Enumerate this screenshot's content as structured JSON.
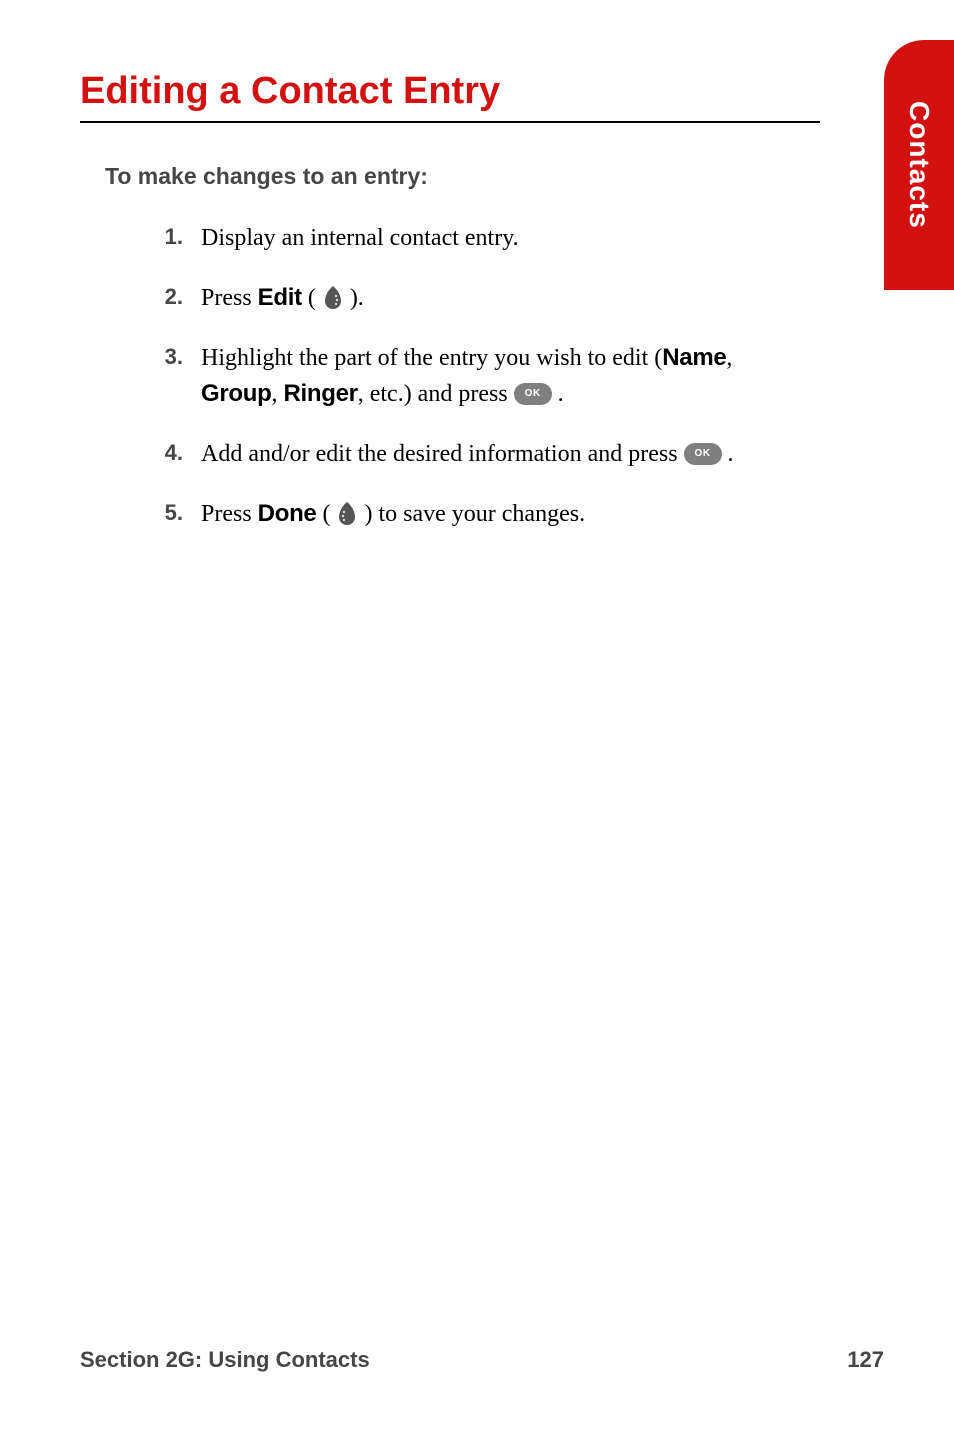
{
  "heading": "Editing a Contact Entry",
  "subheading": "To make changes to an entry:",
  "sideTab": "Contacts",
  "steps": [
    {
      "num": "1.",
      "parts": [
        {
          "text": "Display an internal contact entry."
        }
      ]
    },
    {
      "num": "2.",
      "parts": [
        {
          "text": "Press "
        },
        {
          "text": "Edit",
          "bold": true
        },
        {
          "text": " ( ",
          "nobreak": true
        },
        {
          "icon": "softkey-right"
        },
        {
          "text": " )."
        }
      ]
    },
    {
      "num": "3.",
      "parts": [
        {
          "text": "Highlight the part of the entry you wish to edit ("
        },
        {
          "text": "Name",
          "bold": true
        },
        {
          "text": ", "
        },
        {
          "text": "Group",
          "bold": true
        },
        {
          "text": ", "
        },
        {
          "text": "Ringer",
          "bold": true
        },
        {
          "text": ", etc.) and press "
        },
        {
          "icon": "ok"
        },
        {
          "text": " ."
        }
      ]
    },
    {
      "num": "4.",
      "parts": [
        {
          "text": "Add and/or edit the desired information and press "
        },
        {
          "icon": "ok"
        },
        {
          "text": " ."
        }
      ]
    },
    {
      "num": "5.",
      "parts": [
        {
          "text": "Press "
        },
        {
          "text": "Done",
          "bold": true
        },
        {
          "text": " ( "
        },
        {
          "icon": "softkey-left"
        },
        {
          "text": " ) to save your changes."
        }
      ]
    }
  ],
  "footer": {
    "left": "Section 2G: Using Contacts",
    "right": "127"
  }
}
